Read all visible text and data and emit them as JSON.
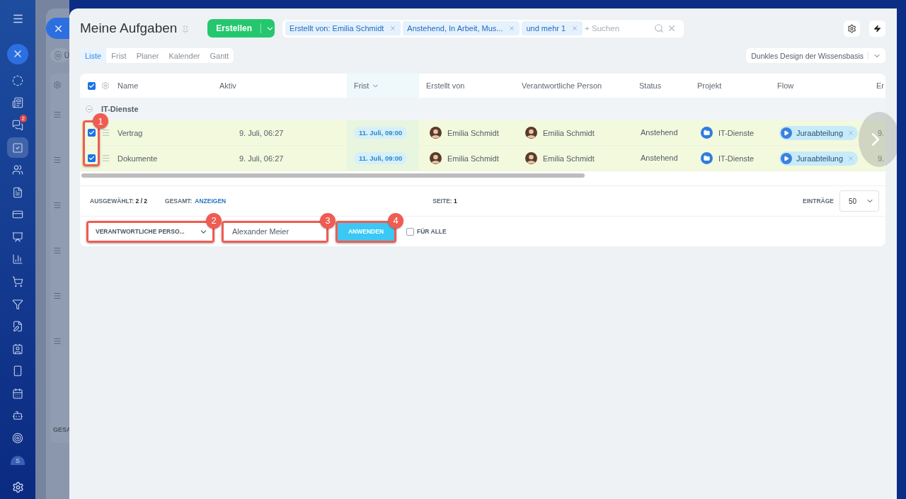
{
  "sidebar": {
    "items": [
      {
        "selected": false
      },
      {
        "selected": false
      },
      {
        "selected": false,
        "badge": "2"
      },
      {
        "selected": true
      },
      {
        "selected": false
      },
      {
        "selected": false
      },
      {
        "selected": false
      },
      {
        "selected": false
      },
      {
        "selected": false
      },
      {
        "selected": false
      },
      {
        "selected": false
      },
      {
        "selected": false
      },
      {
        "selected": false
      },
      {
        "selected": false
      },
      {
        "selected": false
      },
      {
        "selected": false
      },
      {
        "selected": false
      }
    ],
    "avatar": "S"
  },
  "background_panel": {
    "counter": "0",
    "counter_label": "Ü",
    "footer": "GESA"
  },
  "title": "Meine Aufgaben",
  "create_button": "Erstellen",
  "filter": {
    "chips": [
      "Erstellt von: Emilia Schmidt",
      "Anstehend, In Arbeit, Mus...",
      "und mehr 1"
    ],
    "placeholder": "+ Suchen"
  },
  "views": [
    {
      "label": "Liste",
      "selected": true
    },
    {
      "label": "Frist",
      "selected": false
    },
    {
      "label": "Planer",
      "selected": false
    },
    {
      "label": "Kalender",
      "selected": false
    },
    {
      "label": "Gantt",
      "selected": false
    }
  ],
  "theme_select": "Dunkles Design der Wissensbasis",
  "table": {
    "callout": "1",
    "all_checked": true,
    "columns": [
      {
        "label": "Name",
        "sorted": false
      },
      {
        "label": "Aktiv",
        "sorted": false
      },
      {
        "label": "Frist",
        "sorted": true
      },
      {
        "label": "Erstellt von",
        "sorted": false
      },
      {
        "label": "Verantwortliche Person",
        "sorted": false
      },
      {
        "label": "Status",
        "sorted": false
      },
      {
        "label": "Projekt",
        "sorted": false
      },
      {
        "label": "Flow",
        "sorted": false
      },
      {
        "label": "Er",
        "sorted": false
      }
    ],
    "group": "IT-Dienste",
    "rows": [
      {
        "checked": true,
        "name": "Vertrag",
        "active": "9. Juli, 06:27",
        "deadline": "11. Juli, 09:00",
        "created_by": "Emilia Schmidt",
        "responsible": "Emilia Schmidt",
        "status": "Anstehend",
        "project": "IT-Dienste",
        "flow": "Juraabteilung",
        "column_10": "9."
      },
      {
        "checked": true,
        "name": "Dokumente",
        "active": "9. Juli, 06:27",
        "deadline": "11. Juli, 09:00",
        "created_by": "Emilia Schmidt",
        "responsible": "Emilia Schmidt",
        "status": "Anstehend",
        "project": "IT-Dienste",
        "flow": "Juraabteilung",
        "column_10": "9."
      }
    ]
  },
  "footer": {
    "selected_label": "AUSGEWÄHLT:",
    "selected_value": "2 / 2",
    "total_label": "GESAMT:",
    "total_link": "ANZEIGEN",
    "page_label": "SEITE:",
    "page_value": "1",
    "entries_label": "EINTRÄGE",
    "entries_value": "50"
  },
  "action_bar": {
    "field_select": {
      "value": "VERANTWORTLICHE PERSO...",
      "callout": "2"
    },
    "person_input": {
      "value": "Alexander Meier",
      "callout": "3"
    },
    "apply_button": {
      "label": "ANWENDEN",
      "callout": "4"
    },
    "for_all": {
      "label": "FÜR ALLE",
      "checked": false
    }
  }
}
